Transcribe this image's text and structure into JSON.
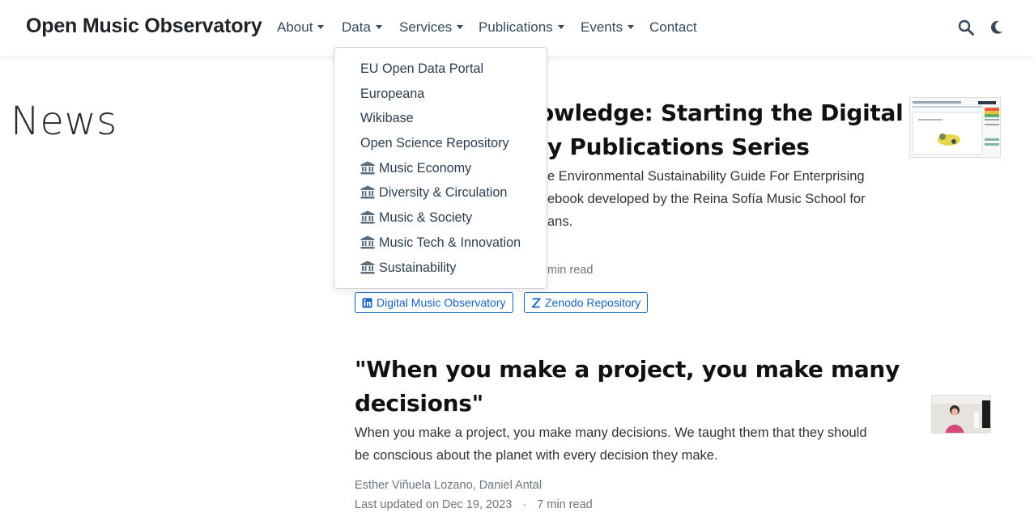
{
  "navbar": {
    "brand": "Open Music Observatory",
    "menu": [
      {
        "label": "About",
        "has_dropdown": true
      },
      {
        "label": "Data",
        "has_dropdown": true
      },
      {
        "label": "Services",
        "has_dropdown": true
      },
      {
        "label": "Publications",
        "has_dropdown": true
      },
      {
        "label": "Events",
        "has_dropdown": true
      },
      {
        "label": "Contact",
        "has_dropdown": false
      }
    ],
    "icons": [
      "search-icon",
      "moon-icon"
    ]
  },
  "data_dropdown": {
    "items": [
      {
        "label": "EU Open Data Portal",
        "icon": ""
      },
      {
        "label": "Europeana",
        "icon": ""
      },
      {
        "label": "Wikibase",
        "icon": ""
      },
      {
        "label": "Open Science Repository",
        "icon": ""
      },
      {
        "label": "Music Economy",
        "icon": "bank-icon"
      },
      {
        "label": "Diversity & Circulation",
        "icon": "bank-icon"
      },
      {
        "label": "Music & Society",
        "icon": "bank-icon"
      },
      {
        "label": "Music Tech & Innovation",
        "icon": "bank-icon"
      },
      {
        "label": "Sustainability",
        "icon": "bank-icon"
      }
    ]
  },
  "page": {
    "title": "News"
  },
  "articles": [
    {
      "title_line1": "owledge: Starting the Digital",
      "title_line2": "y Publications Series",
      "summary_line1": "e Environmental Sustainability Guide For Enterprising",
      "summary_line2": "ebook developed by the Reina Sofía Music School for",
      "summary_line3": "ans.",
      "meta_read": "min read",
      "tags": [
        "Digital Music Observatory",
        "Zenodo Repository"
      ]
    },
    {
      "title": "\"When you make a project, you make many decisions\"",
      "title_line1": "\"When you make a project, you make many",
      "title_line2": "decisions\"",
      "summary_line1": "When you make a project, you make many decisions. We taught them that they should",
      "summary_line2": "be conscious about the planet with every decision they make.",
      "authors": "Esther Viñuela Lozano, Daniel Antal",
      "updated": "Last updated on Dec 19, 2023",
      "separator": "·",
      "read_time": "7 min read"
    }
  ],
  "colors": {
    "accent": "#1565c0",
    "nav_text": "#34495e",
    "muted": "#6c757d"
  }
}
